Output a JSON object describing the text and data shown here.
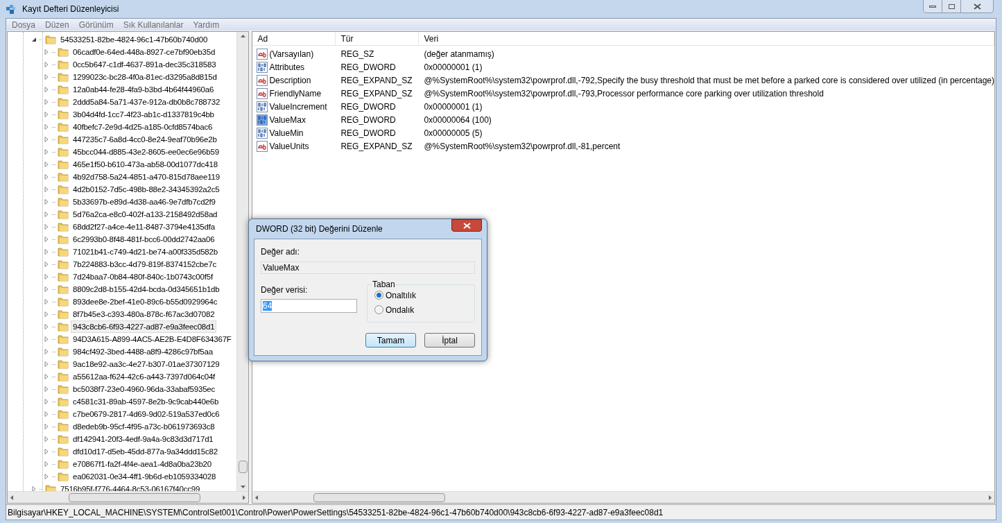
{
  "window": {
    "title": "Kayıt Defteri Düzenleyicisi"
  },
  "menu": [
    "Dosya",
    "Düzen",
    "Görünüm",
    "Sık Kullanılanlar",
    "Yardım"
  ],
  "tree": [
    {
      "label": "54533251-82be-4824-96c1-47b60b740d00",
      "expanded": true,
      "selected": false,
      "children": [
        {
          "label": "06cadf0e-64ed-448a-8927-ce7bf90eb35d",
          "expanded": false,
          "selected": false
        },
        {
          "label": "0cc5b647-c1df-4637-891a-dec35c318583",
          "expanded": false,
          "selected": false
        },
        {
          "label": "1299023c-bc28-4f0a-81ec-d3295a8d815d",
          "expanded": false,
          "selected": false
        },
        {
          "label": "12a0ab44-fe28-4fa9-b3bd-4b64f44960a6",
          "expanded": false,
          "selected": false
        },
        {
          "label": "2ddd5a84-5a71-437e-912a-db0b8c788732",
          "expanded": false,
          "selected": false
        },
        {
          "label": "3b04d4fd-1cc7-4f23-ab1c-d1337819c4bb",
          "expanded": false,
          "selected": false
        },
        {
          "label": "40fbefc7-2e9d-4d25-a185-0cfd8574bac6",
          "expanded": false,
          "selected": false
        },
        {
          "label": "447235c7-6a8d-4cc0-8e24-9eaf70b96e2b",
          "expanded": false,
          "selected": false
        },
        {
          "label": "45bcc044-d885-43e2-8605-ee0ec6e96b59",
          "expanded": false,
          "selected": false
        },
        {
          "label": "465e1f50-b610-473a-ab58-00d1077dc418",
          "expanded": false,
          "selected": false
        },
        {
          "label": "4b92d758-5a24-4851-a470-815d78aee119",
          "expanded": false,
          "selected": false
        },
        {
          "label": "4d2b0152-7d5c-498b-88e2-34345392a2c5",
          "expanded": false,
          "selected": false
        },
        {
          "label": "5b33697b-e89d-4d38-aa46-9e7dfb7cd2f9",
          "expanded": false,
          "selected": false
        },
        {
          "label": "5d76a2ca-e8c0-402f-a133-2158492d58ad",
          "expanded": false,
          "selected": false
        },
        {
          "label": "68dd2f27-a4ce-4e11-8487-3794e4135dfa",
          "expanded": false,
          "selected": false
        },
        {
          "label": "6c2993b0-8f48-481f-bcc6-00dd2742aa06",
          "expanded": false,
          "selected": false
        },
        {
          "label": "71021b41-c749-4d21-be74-a00f335d582b",
          "expanded": false,
          "selected": false
        },
        {
          "label": "7b224883-b3cc-4d79-819f-8374152cbe7c",
          "expanded": false,
          "selected": false
        },
        {
          "label": "7d24baa7-0b84-480f-840c-1b0743c00f5f",
          "expanded": false,
          "selected": false
        },
        {
          "label": "8809c2d8-b155-42d4-bcda-0d345651b1db",
          "expanded": false,
          "selected": false
        },
        {
          "label": "893dee8e-2bef-41e0-89c6-b55d0929964c",
          "expanded": false,
          "selected": false
        },
        {
          "label": "8f7b45e3-c393-480a-878c-f67ac3d07082",
          "expanded": false,
          "selected": false
        },
        {
          "label": "943c8cb6-6f93-4227-ad87-e9a3feec08d1",
          "expanded": false,
          "selected": true
        },
        {
          "label": "94D3A615-A899-4AC5-AE2B-E4D8F634367F",
          "expanded": false,
          "selected": false
        },
        {
          "label": "984cf492-3bed-4488-a8f9-4286c97bf5aa",
          "expanded": false,
          "selected": false
        },
        {
          "label": "9ac18e92-aa3c-4e27-b307-01ae37307129",
          "expanded": false,
          "selected": false
        },
        {
          "label": "a55612aa-f624-42c6-a443-7397d064c04f",
          "expanded": false,
          "selected": false
        },
        {
          "label": "bc5038f7-23e0-4960-96da-33abaf5935ec",
          "expanded": false,
          "selected": false
        },
        {
          "label": "c4581c31-89ab-4597-8e2b-9c9cab440e6b",
          "expanded": false,
          "selected": false
        },
        {
          "label": "c7be0679-2817-4d69-9d02-519a537ed0c6",
          "expanded": false,
          "selected": false
        },
        {
          "label": "d8edeb9b-95cf-4f95-a73c-b061973693c8",
          "expanded": false,
          "selected": false
        },
        {
          "label": "df142941-20f3-4edf-9a4a-9c83d3d717d1",
          "expanded": false,
          "selected": false
        },
        {
          "label": "dfd10d17-d5eb-45dd-877a-9a34ddd15c82",
          "expanded": false,
          "selected": false
        },
        {
          "label": "e70867f1-fa2f-4f4e-aea1-4d8a0ba23b20",
          "expanded": false,
          "selected": false
        },
        {
          "label": "ea062031-0e34-4ff1-9b6d-eb1059334028",
          "expanded": false,
          "selected": false
        }
      ]
    },
    {
      "label": "7516b95f-f776-4464-8c53-06167f40cc99",
      "expanded": false,
      "selected": false
    }
  ],
  "values": {
    "columns": [
      "Ad",
      "Tür",
      "Veri"
    ],
    "rows": [
      {
        "kind": "string",
        "name": "(Varsayılan)",
        "type": "REG_SZ",
        "data": "(değer atanmamış)",
        "selected": false
      },
      {
        "kind": "binary",
        "name": "Attributes",
        "type": "REG_DWORD",
        "data": "0x00000001 (1)",
        "selected": false
      },
      {
        "kind": "string",
        "name": "Description",
        "type": "REG_EXPAND_SZ",
        "data": "@%SystemRoot%\\system32\\powrprof.dll,-792,Specify the busy threshold that must be met before a parked core is considered over utilized (in percentage)",
        "selected": false
      },
      {
        "kind": "string",
        "name": "FriendlyName",
        "type": "REG_EXPAND_SZ",
        "data": "@%SystemRoot%\\system32\\powrprof.dll,-793,Processor performance core parking over utilization threshold",
        "selected": false
      },
      {
        "kind": "binary",
        "name": "ValueIncrement",
        "type": "REG_DWORD",
        "data": "0x00000001 (1)",
        "selected": false
      },
      {
        "kind": "binary",
        "name": "ValueMax",
        "type": "REG_DWORD",
        "data": "0x00000064 (100)",
        "selected": true
      },
      {
        "kind": "binary",
        "name": "ValueMin",
        "type": "REG_DWORD",
        "data": "0x00000005 (5)",
        "selected": false
      },
      {
        "kind": "string",
        "name": "ValueUnits",
        "type": "REG_EXPAND_SZ",
        "data": "@%SystemRoot%\\system32\\powrprof.dll,-81,percent",
        "selected": false
      }
    ]
  },
  "dialog": {
    "title": "DWORD (32 bit) Değerini Düzenle",
    "name_label": "Değer adı:",
    "name_value": "ValueMax",
    "data_label": "Değer verisi:",
    "data_value": "64",
    "base_label": "Taban",
    "base_options": [
      {
        "label": "Onaltılık",
        "selected": true
      },
      {
        "label": "Ondalık",
        "selected": false
      }
    ],
    "buttons": [
      {
        "label": "Tamam",
        "default": true
      },
      {
        "label": "İptal",
        "default": false
      }
    ]
  },
  "status_bar": "Bilgisayar\\HKEY_LOCAL_MACHINE\\SYSTEM\\ControlSet001\\Control\\Power\\PowerSettings\\54533251-82be-4824-96c1-47b60b740d00\\943c8cb6-6f93-4227-ad87-e9a3feec08d1"
}
